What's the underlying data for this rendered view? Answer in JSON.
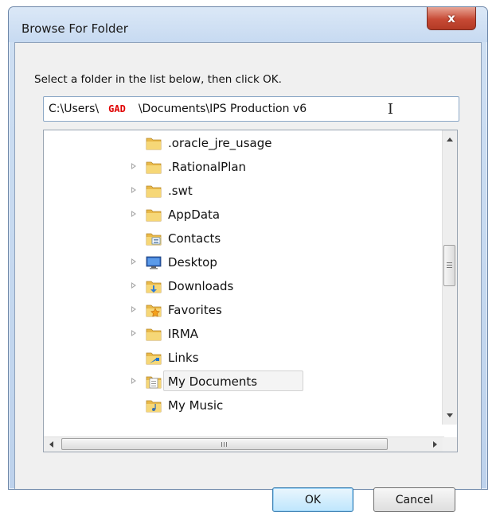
{
  "window": {
    "title": "Browse For Folder",
    "close_label": "x"
  },
  "dialog": {
    "instruction": "Select a folder in the list below, then click OK."
  },
  "path": {
    "prefix": "C:\\Users\\",
    "user": "GAD",
    "suffix": "\\Documents\\IPS Production v6",
    "caret_glyph": "I"
  },
  "tree": {
    "items": [
      {
        "label": ".oracle_jre_usage",
        "expander": false,
        "icon": "folder-icon"
      },
      {
        "label": ".RationalPlan",
        "expander": true,
        "icon": "folder-icon"
      },
      {
        "label": ".swt",
        "expander": true,
        "icon": "folder-icon"
      },
      {
        "label": "AppData",
        "expander": true,
        "icon": "folder-icon"
      },
      {
        "label": "Contacts",
        "expander": false,
        "icon": "contacts-folder-icon"
      },
      {
        "label": "Desktop",
        "expander": true,
        "icon": "desktop-icon"
      },
      {
        "label": "Downloads",
        "expander": true,
        "icon": "downloads-folder-icon"
      },
      {
        "label": "Favorites",
        "expander": true,
        "icon": "favorites-folder-icon"
      },
      {
        "label": "IRMA",
        "expander": true,
        "icon": "folder-icon"
      },
      {
        "label": "Links",
        "expander": false,
        "icon": "links-folder-icon"
      },
      {
        "label": "My Documents",
        "expander": true,
        "icon": "documents-folder-icon",
        "selected": true
      },
      {
        "label": "My Music",
        "expander": false,
        "icon": "music-folder-icon"
      }
    ],
    "vertical_scroll_glyph": "≡",
    "horizontal_scroll_glyph": "III"
  },
  "buttons": {
    "ok_label": "OK",
    "cancel_label": "Cancel"
  },
  "colors": {
    "user_highlight": "#e00000",
    "folder": "#f2c94c",
    "ok_border": "#3c7fb1"
  }
}
